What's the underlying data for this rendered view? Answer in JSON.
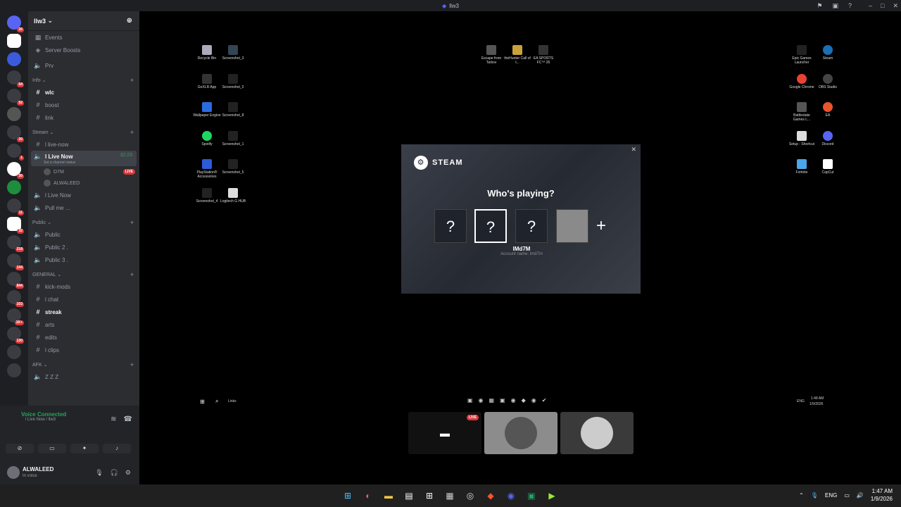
{
  "window": {
    "title": "llw3"
  },
  "guild": {
    "name": "llw3"
  },
  "channels": {
    "events": "Events",
    "boosts": "Server Boosts",
    "prv": "Prv",
    "cat_info": "Info",
    "wlc": "wlc",
    "boost": "boost",
    "link": "link",
    "cat_stream": "Stream",
    "live_now_text": "l live-now",
    "live_now_voice": "l Live Now",
    "live_time": "32:23",
    "live_sub": "Set a channel status",
    "member1": "D7M",
    "member1_badge": "LIVE",
    "member2": "ALWALEED",
    "live_now_2": "l Live Now",
    "pull": "Pull me ...",
    "cat_public": "Public",
    "public1": "Public",
    "public2": "Public 2 .",
    "public3": "Public 3 .",
    "cat_general": "GENERAL",
    "kick": "kick-mods",
    "chat": "l chat",
    "streak": "streak",
    "arts": "arts",
    "edits": "edits",
    "clips": "l clips",
    "cat_afk": "AFK",
    "zzz": "Z Z Z"
  },
  "servers": {
    "badges": [
      "26",
      "64",
      "52",
      "20",
      "1",
      "30",
      "11",
      "32",
      "218",
      "144",
      "844",
      "103",
      "1K+",
      "130"
    ]
  },
  "voice": {
    "status": "Voice Connected",
    "location": "l Live Now / llw3"
  },
  "user": {
    "name": "ALWALEED",
    "status": "In voice"
  },
  "steam": {
    "brand": "STEAM",
    "prompt": "Who's playing?",
    "unknown": "?",
    "account": "lMd7M",
    "account_name": "Account name: lmd7m"
  },
  "desktop": {
    "icons": [
      "Recycle Bin",
      "Screenshot_3",
      "GoXLR App",
      "Screenshot_2",
      "Wallpaper Engine",
      "Screenshot_8",
      "Spotify",
      "Screenshot_1",
      "PlayStation® Accessories",
      "Screenshot_5",
      "Screenshot_4",
      "Logitech G HUB",
      "Escape from Tarkov",
      "theHunter Call of t...",
      "EA SPORTS FC™ 26",
      "Epic Games Launcher",
      "Steam",
      "Google Chrome",
      "OBS Studio",
      "Battlestate Games L...",
      "EA",
      "Setup - Shortcut",
      "Discord",
      "Fortnite",
      "CapCut"
    ],
    "search": "Links",
    "lang": "ENG",
    "time": "1:48 AM",
    "date": "1/9/2026"
  },
  "stream_tiles": {
    "live_badge": "LIVE"
  },
  "taskbar": {
    "lang": "ENG",
    "time": "1:47 AM",
    "date": "1/9/2026"
  }
}
